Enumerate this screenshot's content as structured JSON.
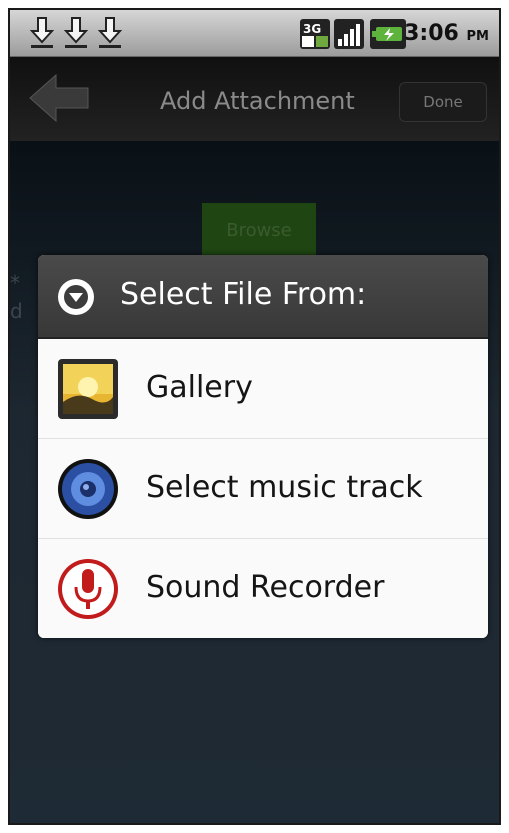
{
  "status_bar": {
    "time": "3:06",
    "ampm": "PM",
    "icons": [
      "download-icon",
      "download-icon",
      "download-icon",
      "3g-icon",
      "signal-icon",
      "battery-icon"
    ]
  },
  "title_bar": {
    "title": "Add Attachment",
    "done_label": "Done"
  },
  "background": {
    "browse_label": "Browse",
    "side_chars": [
      "*",
      "d"
    ]
  },
  "dialog": {
    "title": "Select File From:",
    "options": [
      {
        "label": "Gallery",
        "icon": "gallery-icon"
      },
      {
        "label": "Select music track",
        "icon": "music-speaker-icon"
      },
      {
        "label": "Sound Recorder",
        "icon": "microphone-icon"
      }
    ]
  }
}
